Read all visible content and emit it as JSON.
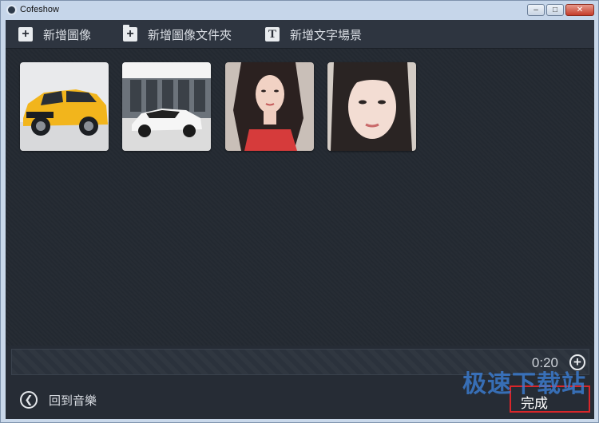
{
  "window": {
    "title": "Cofeshow",
    "minimize_icon": "minimize-icon",
    "maximize_icon": "maximize-icon",
    "close_icon": "close-icon"
  },
  "toolbar": {
    "add_image": {
      "label": "新增圖像",
      "icon": "plus-icon"
    },
    "add_folder": {
      "label": "新增圖像文件夾",
      "icon": "folder-plus-icon"
    },
    "add_text": {
      "label": "新增文字場景",
      "icon": "text-icon"
    }
  },
  "thumbnails": [
    {
      "subject": "yellow SUV",
      "colors": [
        "#e6e8ea",
        "#f2b51c"
      ]
    },
    {
      "subject": "white sports car",
      "colors": [
        "#505860",
        "#f0f0f0"
      ]
    },
    {
      "subject": "woman in red dress",
      "colors": [
        "#cdbfb6",
        "#d63b3b"
      ]
    },
    {
      "subject": "woman portrait",
      "colors": [
        "#cfc6bd",
        "#2a2423"
      ]
    }
  ],
  "timeline": {
    "duration": "0:20",
    "add_icon": "plus-circle-icon"
  },
  "bottom": {
    "back_label": "回到音樂",
    "back_icon": "back-arrow-icon",
    "done_label": "完成"
  },
  "watermark": "极速下载站",
  "colors": {
    "background": "#262c35",
    "toolbar": "#2e3540",
    "done_border": "#d9262a",
    "watermark": "#3c7dd2"
  }
}
